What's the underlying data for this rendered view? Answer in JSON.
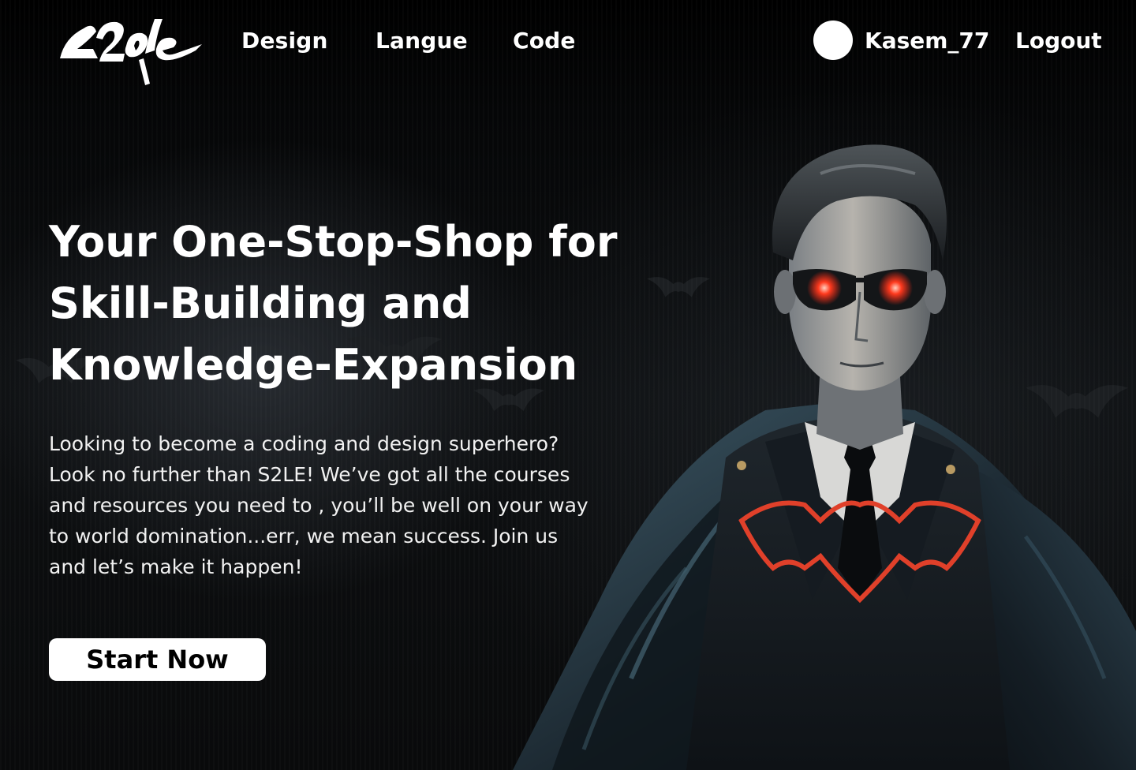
{
  "brand": {
    "logo_alt": "S2LE",
    "logo_icon": "s2le-logo"
  },
  "nav": {
    "links": [
      {
        "label": "Design"
      },
      {
        "label": "Langue"
      },
      {
        "label": "Code"
      }
    ]
  },
  "user": {
    "avatar_icon": "avatar-circle",
    "username": "Kasem_77",
    "logout_label": "Logout"
  },
  "hero": {
    "headline": "Your One-Stop-Shop for Skill-Building and Knowledge-Expansion",
    "description": "Looking to become a coding and design superhero? Look no further than S2LE! We’ve got all the courses and resources you need to , you’ll be well on your way to world domination...err, we mean success. Join us and let’s make it happen!",
    "cta_label": "Start Now",
    "illustration": "superhero-villain-in-suit-with-cape-and-glowing-red-eyes"
  },
  "colors": {
    "background": "#000000",
    "text": "#ffffff",
    "button_bg": "#ffffff",
    "button_text": "#000000",
    "accent_red": "#e0402a"
  }
}
